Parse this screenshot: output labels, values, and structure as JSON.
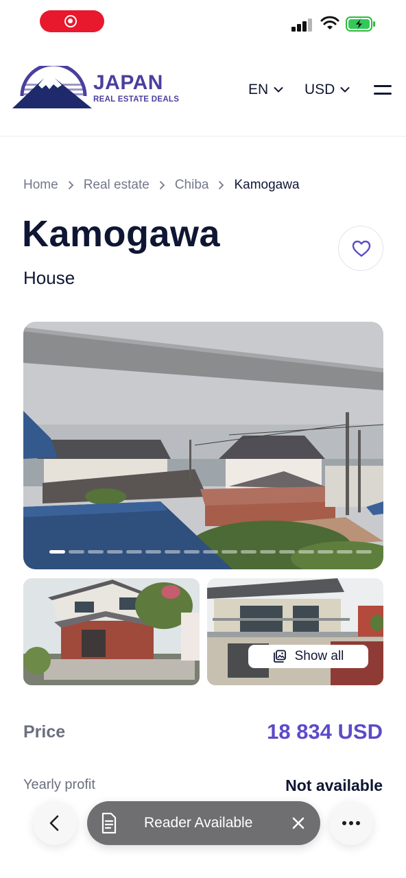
{
  "header": {
    "logo_title": "JAPAN",
    "logo_subtitle": "REAL ESTATE DEALS",
    "language": "EN",
    "currency": "USD"
  },
  "breadcrumb": [
    "Home",
    "Real estate",
    "Chiba",
    "Kamogawa"
  ],
  "listing": {
    "title": "Kamogawa",
    "type": "House"
  },
  "gallery": {
    "show_all_label": "Show all",
    "photo_count": 17,
    "active_index": 0
  },
  "details": {
    "price_label": "Price",
    "price_value": "18 834 USD",
    "profit_label": "Yearly profit",
    "profit_value": "Not available"
  },
  "browser_toolbar": {
    "reader_label": "Reader Available"
  },
  "colors": {
    "accent": "#5b4bc9",
    "text_dark": "#0f1633",
    "text_muted": "#6b6e7e",
    "record_pill": "#e8192c"
  },
  "icons": [
    "record-icon",
    "signal-icon",
    "wifi-icon",
    "battery-charging-icon",
    "chevron-down-icon",
    "menu-icon",
    "chevron-right-icon",
    "heart-icon",
    "gallery-icon",
    "back-arrow-icon",
    "reader-icon",
    "close-icon",
    "more-icon"
  ]
}
